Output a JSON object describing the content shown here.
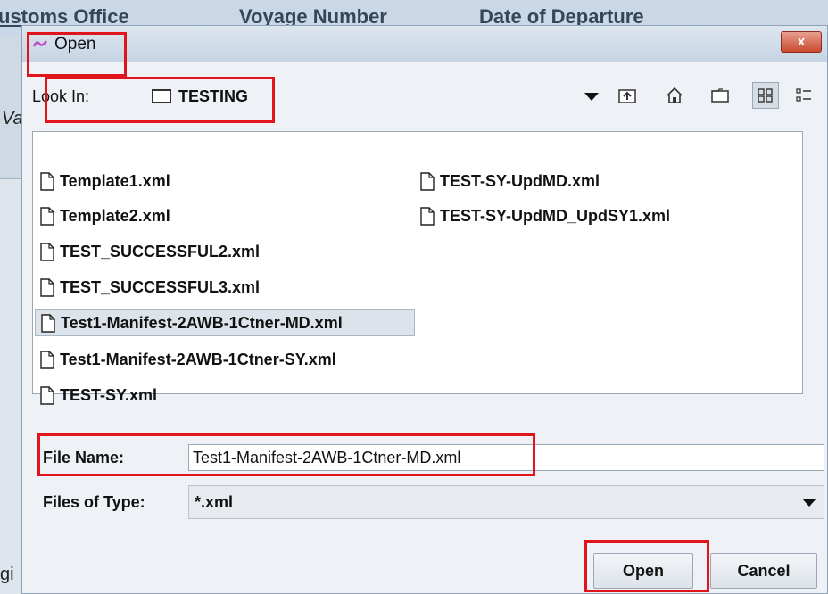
{
  "background": {
    "columns": [
      "ustoms Office",
      "Voyage Number",
      "Date of Departure"
    ],
    "left_edge_text": "Va",
    "bottom_left_text": "gi"
  },
  "dialog": {
    "title": "Open",
    "close_label": "x",
    "look_in": {
      "label": "Look In:",
      "value": "TESTING"
    },
    "toolbar": {
      "icons": [
        "up-folder-icon",
        "home-icon",
        "new-folder-icon",
        "list-view-icon",
        "details-view-icon"
      ]
    },
    "files": [
      {
        "name": "Template1.xml",
        "selected": false
      },
      {
        "name": "Template2.xml",
        "selected": false
      },
      {
        "name": "TEST_SUCCESSFUL2.xml",
        "selected": false
      },
      {
        "name": "TEST_SUCCESSFUL3.xml",
        "selected": false
      },
      {
        "name": "Test1-Manifest-2AWB-1Ctner-MD.xml",
        "selected": true
      },
      {
        "name": "Test1-Manifest-2AWB-1Ctner-SY.xml",
        "selected": false
      },
      {
        "name": "TEST-SY.xml",
        "selected": false
      },
      {
        "name": "TEST-SY-UpdMD.xml",
        "selected": false
      },
      {
        "name": "TEST-SY-UpdMD_UpdSY1.xml",
        "selected": false
      }
    ],
    "file_name": {
      "label": "File Name:",
      "value": "Test1-Manifest-2AWB-1Ctner-MD.xml"
    },
    "files_of_type": {
      "label": "Files of Type:",
      "value": "*.xml"
    },
    "buttons": {
      "open": "Open",
      "cancel": "Cancel"
    },
    "colors": {
      "highlight_box": "#e0141b",
      "selection": "#dde3ea"
    }
  }
}
